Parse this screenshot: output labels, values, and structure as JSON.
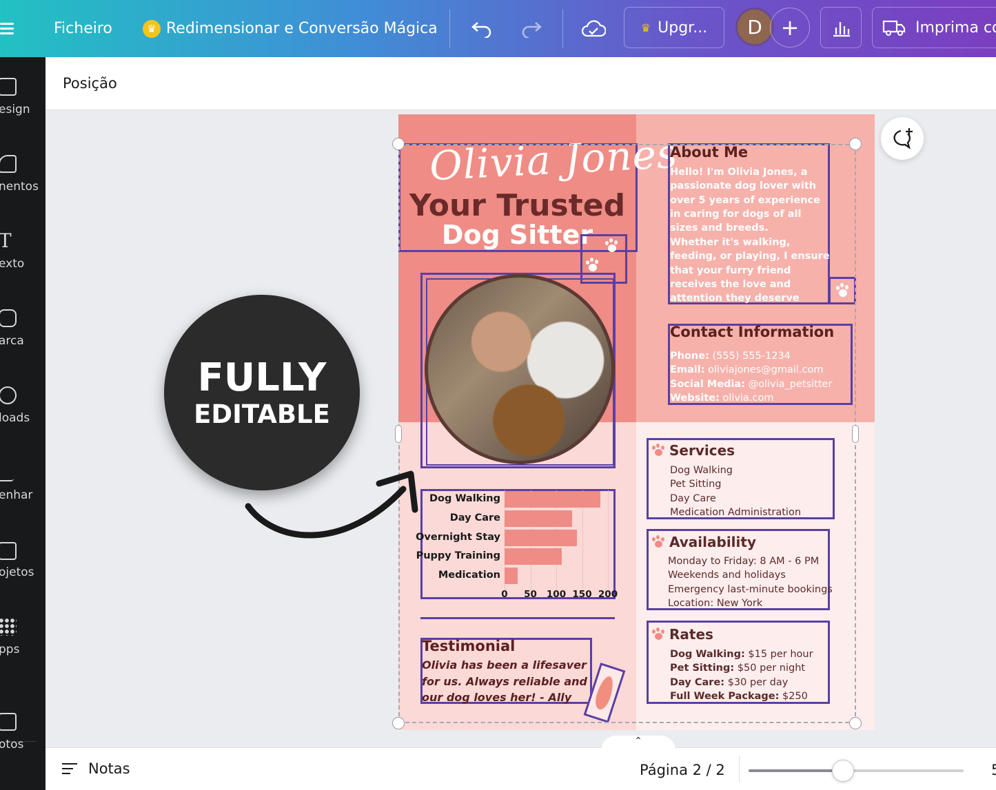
{
  "topbar": {
    "file": "Ficheiro",
    "magic_resize": "Redimensionar e Conversão Mágica",
    "upgrade": "Upgr...",
    "avatar_initial": "D",
    "print": "Imprima co"
  },
  "sidebar": {
    "items": [
      {
        "label": "esign",
        "icon": "layout-icon"
      },
      {
        "label": "nentos",
        "icon": "shapes-icon"
      },
      {
        "label": "exto",
        "icon": "text-icon"
      },
      {
        "label": "arca",
        "icon": "brand-icon"
      },
      {
        "label": "loads",
        "icon": "upload-icon"
      },
      {
        "label": "enhar",
        "icon": "draw-icon"
      },
      {
        "label": "ojetos",
        "icon": "folder-icon"
      },
      {
        "label": "pps",
        "icon": "apps-icon"
      },
      {
        "label": "otos",
        "icon": "photos-icon"
      }
    ]
  },
  "subheader": {
    "position": "Posição"
  },
  "bottombar": {
    "notes": "Notas",
    "page": "Página 2 / 2",
    "zoom_fraction": 0.44,
    "zoom_partial": "5"
  },
  "badge": {
    "line1": "FULLY",
    "line2": "EDITABLE"
  },
  "flyer": {
    "name": "Olivia Jones",
    "headline": "Your Trusted",
    "subheadline": "Dog Sitter",
    "about_title": "About Me",
    "about_text_1": "Hello! I'm Olivia Jones, a passionate dog lover with over 5 years of experience in caring for dogs of all sizes and breeds.",
    "about_text_2": "Whether it's walking, feeding, or playing, I ensure that your furry friend receives the love and attention they deserve while you're away.",
    "contact_title": "Contact Information",
    "contact": [
      {
        "label": "Phone:",
        "value": "(555) 555-1234"
      },
      {
        "label": "Email:",
        "value": "oliviajones@gmail.com"
      },
      {
        "label": "Social Media:",
        "value": "@olivia_petsitter"
      },
      {
        "label": "Website:",
        "value": "olivia.com"
      }
    ],
    "services_title": "Services",
    "services": [
      "Dog Walking",
      "Pet Sitting",
      "Day Care",
      "Medication Administration"
    ],
    "availability_title": "Availability",
    "availability": [
      "Monday to Friday: 8 AM - 6 PM",
      "Weekends and holidays",
      "Emergency last-minute bookings",
      "Location: New York"
    ],
    "rates_title": "Rates",
    "rates": [
      {
        "label": "Dog Walking:",
        "value": "$15 per hour"
      },
      {
        "label": "Pet Sitting:",
        "value": "$50 per night"
      },
      {
        "label": "Day Care:",
        "value": "$30 per day"
      },
      {
        "label": "Full Week Package:",
        "value": "$250"
      }
    ],
    "testimonial_title": "Testimonial",
    "testimonial_text": "Olivia has been a lifesaver for us. Always reliable and our dog loves her! - Ally"
  },
  "colors": {
    "accent_coral": "#ef8c85",
    "selection_purple": "#5a3fa3",
    "text_maroon": "#5b2020"
  },
  "chart_data": {
    "type": "bar",
    "orientation": "horizontal",
    "categories": [
      "Dog Walking",
      "Day Care",
      "Overnight Stay",
      "Puppy Training",
      "Medication"
    ],
    "values": [
      185,
      130,
      140,
      110,
      25
    ],
    "xlim": [
      0,
      200
    ],
    "xticks": [
      "0",
      "50",
      "100",
      "150",
      "200"
    ],
    "grid": true
  }
}
